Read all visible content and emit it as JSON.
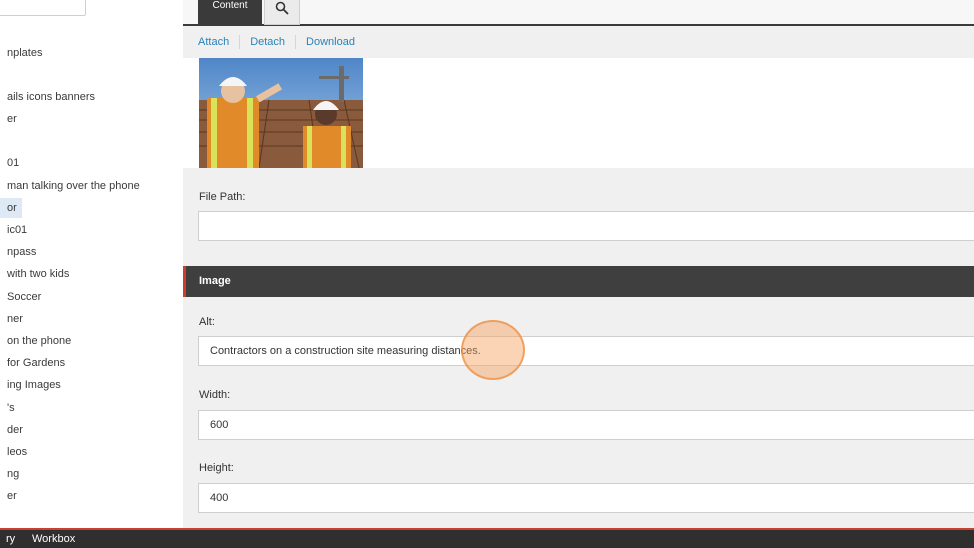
{
  "tree": {
    "items": [
      {
        "label": "nplates"
      },
      {
        "label": "ails icons banners"
      },
      {
        "label": "er"
      },
      {
        "label": "01"
      },
      {
        "label": "man talking over the phone"
      },
      {
        "label": "or"
      },
      {
        "label": "ic01"
      },
      {
        "label": "npass"
      },
      {
        "label": "with two kids"
      },
      {
        "label": "Soccer"
      },
      {
        "label": "ner"
      },
      {
        "label": "on the phone"
      },
      {
        "label": "for Gardens"
      },
      {
        "label": "ing Images"
      },
      {
        "label": "'s"
      },
      {
        "label": "der"
      },
      {
        "label": "leos"
      },
      {
        "label": "ng"
      },
      {
        "label": "er"
      }
    ]
  },
  "tabs": {
    "content_label": "Content"
  },
  "actions": {
    "attach": "Attach",
    "detach": "Detach",
    "download": "Download"
  },
  "fields": {
    "file_path_label": "File Path:",
    "file_path_value": "",
    "section_title": "Image",
    "alt_label": "Alt:",
    "alt_value": "Contractors on a construction site measuring distances.",
    "width_label": "Width:",
    "width_value": "600",
    "height_label": "Height:",
    "height_value": "400"
  },
  "bottombar": {
    "item1": "ry",
    "item2": "Workbox"
  },
  "colors": {
    "accent_red": "#d23a2a",
    "link_blue": "#2a82b8",
    "dark_bar": "#3f3f3f"
  }
}
